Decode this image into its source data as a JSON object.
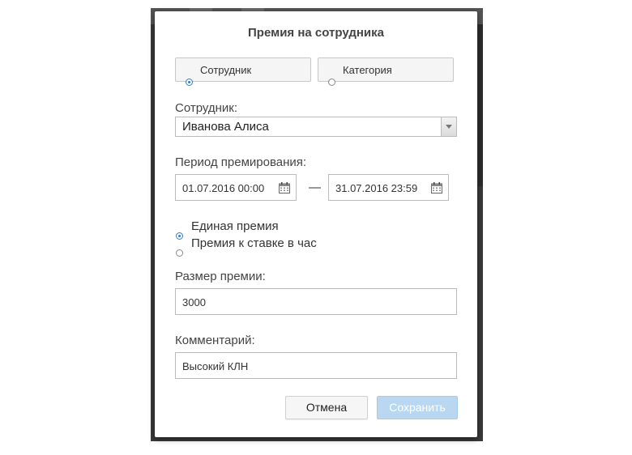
{
  "dialog": {
    "title": "Премия на сотрудника",
    "mode_tabs": [
      {
        "label": "Сотрудник",
        "selected": true
      },
      {
        "label": "Категория",
        "selected": false
      }
    ],
    "employee_label": "Сотрудник:",
    "employee_value": "Иванова Алиса",
    "period_label": "Период премирования:",
    "period_from": "01.07.2016 00:00",
    "period_separator": "—",
    "period_to": "31.07.2016 23:59",
    "bonus_type_options": [
      {
        "label": "Единая премия",
        "selected": true
      },
      {
        "label": "Премия к ставке в час",
        "selected": false
      }
    ],
    "amount_label": "Размер премии:",
    "amount_value": "3000",
    "comment_label": "Комментарий:",
    "comment_value": "Высокий КЛН",
    "cancel_label": "Отмена",
    "save_label": "Сохранить"
  },
  "colors": {
    "accent": "#2a7fd4",
    "save_disabled_bg": "#b9d7f0"
  },
  "icons": {
    "date_picker": "calendar-icon",
    "dropdown": "chevron-down-icon"
  }
}
